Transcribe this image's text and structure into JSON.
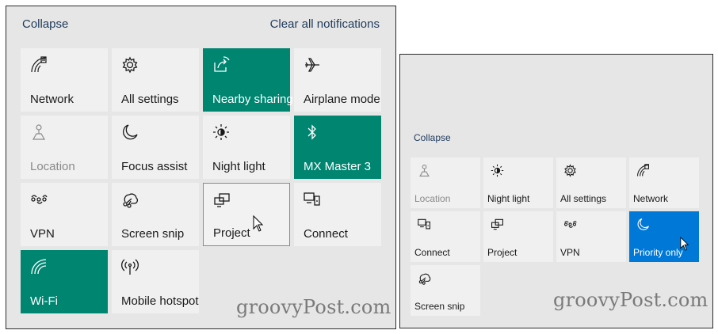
{
  "left_panel": {
    "collapse_label": "Collapse",
    "clear_label": "Clear all notifications",
    "tiles": [
      {
        "label": "Network",
        "icon": "network-icon",
        "state": "off"
      },
      {
        "label": "All settings",
        "icon": "gear-icon",
        "state": "off"
      },
      {
        "label": "Nearby sharing",
        "icon": "share-icon",
        "state": "on"
      },
      {
        "label": "Airplane mode",
        "icon": "airplane-icon",
        "state": "off"
      },
      {
        "label": "Location",
        "icon": "location-icon",
        "state": "disabled"
      },
      {
        "label": "Focus assist",
        "icon": "moon-icon",
        "state": "off"
      },
      {
        "label": "Night light",
        "icon": "brightness-icon",
        "state": "off"
      },
      {
        "label": "MX Master 3",
        "icon": "bluetooth-icon",
        "state": "on"
      },
      {
        "label": "VPN",
        "icon": "vpn-icon",
        "state": "off"
      },
      {
        "label": "Screen snip",
        "icon": "snip-icon",
        "state": "off"
      },
      {
        "label": "Project",
        "icon": "project-icon",
        "state": "hover"
      },
      {
        "label": "Connect",
        "icon": "connect-icon",
        "state": "off"
      },
      {
        "label": "Wi-Fi",
        "icon": "wifi-icon",
        "state": "on"
      },
      {
        "label": "Mobile hotspot",
        "icon": "hotspot-icon",
        "state": "off"
      }
    ],
    "watermark": "groovyPost.com"
  },
  "right_panel": {
    "collapse_label": "Collapse",
    "tiles": [
      {
        "label": "Location",
        "icon": "location-icon",
        "state": "disabled"
      },
      {
        "label": "Night light",
        "icon": "brightness-icon",
        "state": "off"
      },
      {
        "label": "All settings",
        "icon": "gear-icon",
        "state": "off"
      },
      {
        "label": "Network",
        "icon": "network-icon",
        "state": "off"
      },
      {
        "label": "Connect",
        "icon": "connect-icon",
        "state": "off"
      },
      {
        "label": "Project",
        "icon": "project-icon",
        "state": "off"
      },
      {
        "label": "VPN",
        "icon": "vpn-icon",
        "state": "off"
      },
      {
        "label": "Priority only",
        "icon": "moon-icon",
        "state": "on"
      },
      {
        "label": "Screen snip",
        "icon": "snip-icon",
        "state": "off"
      }
    ],
    "watermark": "groovyPost.com"
  },
  "colors": {
    "panel_bg": "#e6e6e6",
    "tile_bg": "#f0f0f0",
    "accent_green": "#008571",
    "accent_blue": "#0078d7",
    "header_text": "#1f3a5c"
  }
}
